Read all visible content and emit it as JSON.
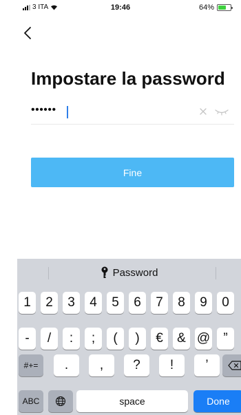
{
  "status_bar": {
    "carrier": "3 ITA",
    "time": "19:46",
    "battery_percent": "64%",
    "battery_level": 0.64
  },
  "header": {
    "back_icon": "chevron-left-icon"
  },
  "page": {
    "title": "Impostare la password"
  },
  "password_field": {
    "value_masked": "••••••",
    "clear_icon": "close-icon",
    "visibility_icon": "eye-closed-icon"
  },
  "actions": {
    "done_label": "Fine",
    "done_color": "#4db8f5"
  },
  "keyboard": {
    "suggestion_icon": "key-icon",
    "suggestion_label": "Password",
    "row1": [
      "1",
      "2",
      "3",
      "4",
      "5",
      "6",
      "7",
      "8",
      "9",
      "0"
    ],
    "row2": [
      "-",
      "/",
      ":",
      ";",
      "(",
      ")",
      "€",
      "&",
      "@",
      "”"
    ],
    "row3_mode": "#+=",
    "row3": [
      ".",
      ",",
      "?",
      "!",
      "’"
    ],
    "delete_icon": "backspace-icon",
    "abc_label": "ABC",
    "globe_icon": "globe-icon",
    "space_label": "space",
    "done_label": "Done",
    "done_color": "#1a7ef6"
  }
}
